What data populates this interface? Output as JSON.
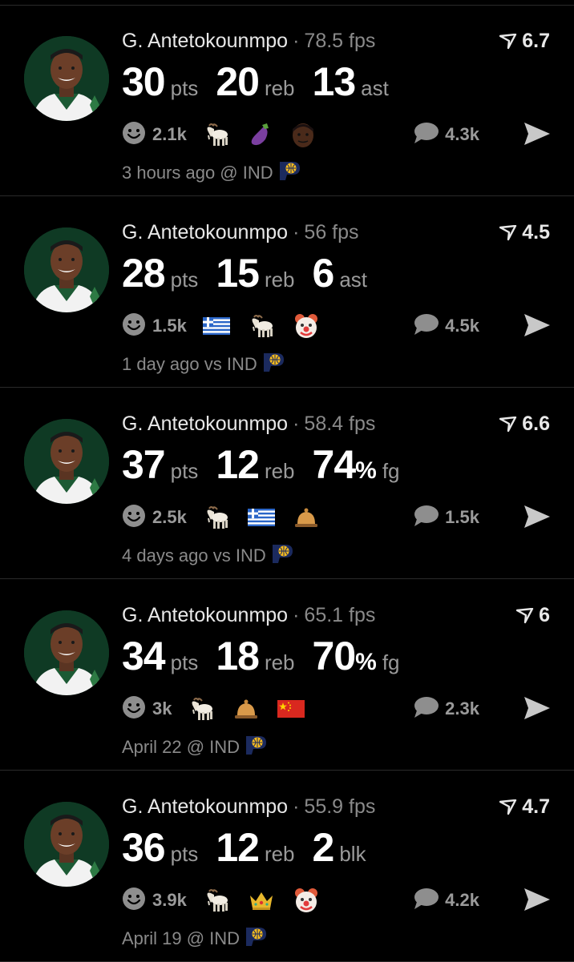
{
  "posts": [
    {
      "player": "G. Antetokounmpo",
      "fps": "78.5 fps",
      "score": "6.7",
      "stats": [
        {
          "value": "30",
          "pct": "",
          "unit": "pts"
        },
        {
          "value": "20",
          "pct": "",
          "unit": "reb"
        },
        {
          "value": "13",
          "pct": "",
          "unit": "ast"
        }
      ],
      "reactions": "2.1k",
      "emojis": [
        "goat-icon",
        "eggplant-icon",
        "player-face-icon"
      ],
      "comments": "4.3k",
      "meta": "3 hours ago @ IND"
    },
    {
      "player": "G. Antetokounmpo",
      "fps": "56 fps",
      "score": "4.5",
      "stats": [
        {
          "value": "28",
          "pct": "",
          "unit": "pts"
        },
        {
          "value": "15",
          "pct": "",
          "unit": "reb"
        },
        {
          "value": "6",
          "pct": "",
          "unit": "ast"
        }
      ],
      "reactions": "1.5k",
      "emojis": [
        "greece-flag-icon",
        "goat-icon",
        "clown-icon"
      ],
      "comments": "4.5k",
      "meta": "1 day ago vs IND"
    },
    {
      "player": "G. Antetokounmpo",
      "fps": "58.4 fps",
      "score": "6.6",
      "stats": [
        {
          "value": "37",
          "pct": "",
          "unit": "pts"
        },
        {
          "value": "12",
          "pct": "",
          "unit": "reb"
        },
        {
          "value": "74",
          "pct": "%",
          "unit": "fg"
        }
      ],
      "reactions": "2.5k",
      "emojis": [
        "goat-icon",
        "greece-flag-icon",
        "bell-icon"
      ],
      "comments": "1.5k",
      "meta": "4 days ago vs IND"
    },
    {
      "player": "G. Antetokounmpo",
      "fps": "65.1 fps",
      "score": "6",
      "stats": [
        {
          "value": "34",
          "pct": "",
          "unit": "pts"
        },
        {
          "value": "18",
          "pct": "",
          "unit": "reb"
        },
        {
          "value": "70",
          "pct": "%",
          "unit": "fg"
        }
      ],
      "reactions": "3k",
      "emojis": [
        "goat-icon",
        "bell-icon",
        "china-flag-icon"
      ],
      "comments": "2.3k",
      "meta": "April 22 @ IND"
    },
    {
      "player": "G. Antetokounmpo",
      "fps": "55.9 fps",
      "score": "4.7",
      "stats": [
        {
          "value": "36",
          "pct": "",
          "unit": "pts"
        },
        {
          "value": "12",
          "pct": "",
          "unit": "reb"
        },
        {
          "value": "2",
          "pct": "",
          "unit": "blk"
        }
      ],
      "reactions": "3.9k",
      "emojis": [
        "goat-icon",
        "crown-icon",
        "clown-icon"
      ],
      "comments": "4.2k",
      "meta": "April 19 @ IND"
    }
  ],
  "icons": {
    "score": "upvote-arrow-icon",
    "reaction": "smiley-icon",
    "comment": "speech-bubble-icon",
    "share": "share-arrow-icon",
    "team": "pacers-logo-icon",
    "avatar": "player-avatar"
  },
  "colors": {
    "background": "#000000",
    "primary_text": "#ffffff",
    "secondary_text": "#8a8a8a",
    "divider": "#2a2a2a",
    "pacers_navy": "#1b2a5e",
    "pacers_gold": "#f9bd1e"
  }
}
